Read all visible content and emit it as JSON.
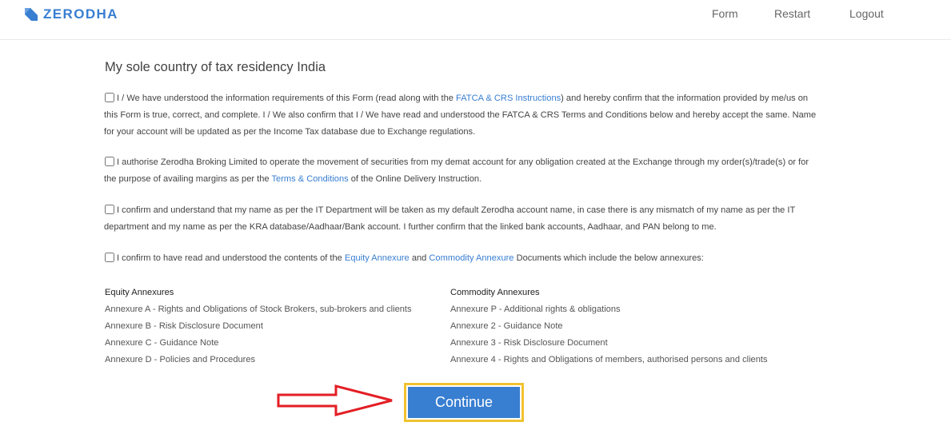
{
  "header": {
    "brand": "ZERODHA",
    "nav": {
      "form": "Form",
      "restart": "Restart",
      "logout": "Logout"
    }
  },
  "colors": {
    "accent": "#387ed1",
    "highlight_border": "#f2c230",
    "arrow": "#e31e24"
  },
  "title": "My sole country of tax residency India",
  "declarations": [
    {
      "checked": false,
      "t1": "I / We have understood the information requirements of this Form (read along with the ",
      "link1": "FATCA & CRS Instructions",
      "t2": ") and hereby confirm that the information provided by me/us on this Form is true, correct, and complete. I / We also confirm that I / We have read and understood the FATCA & CRS Terms and Conditions below and hereby accept the same. Name for your account will be updated as per the Income Tax database due to Exchange regulations."
    },
    {
      "checked": false,
      "t1": "I authorise Zerodha Broking Limited to operate the movement of securities from my demat account for any obligation created at the Exchange through my order(s)/trade(s) or for the purpose of availing margins as per the ",
      "link1": "Terms & Conditions",
      "t2": " of the Online Delivery Instruction."
    },
    {
      "checked": false,
      "t1": "I confirm and understand that my name as per the IT Department will be taken as my default Zerodha account name, in case there is any mismatch of my name as per the IT department and my name as per the KRA database/Aadhaar/Bank account. I further confirm that the linked bank accounts, Aadhaar, and PAN belong to me."
    },
    {
      "checked": false,
      "t1": "I confirm to have read and understood the contents of the ",
      "link1": "Equity Annexure",
      "t2": " and ",
      "link2": "Commodity Annexure",
      "t3": " Documents which include the below annexures:"
    }
  ],
  "annexures": {
    "equity": {
      "heading": "Equity Annexures",
      "items": [
        "Annexure A - Rights and Obligations of Stock Brokers, sub-brokers and clients",
        "Annexure B - Risk Disclosure Document",
        "Annexure C - Guidance Note",
        "Annexure D - Policies and Procedures"
      ]
    },
    "commodity": {
      "heading": "Commodity Annexures",
      "items": [
        "Annexure P - Additional rights & obligations",
        "Annexure 2 - Guidance Note",
        "Annexure 3 - Risk Disclosure Document",
        "Annexure 4 - Rights and Obligations of members, authorised persons and clients"
      ]
    }
  },
  "continue_label": "Continue",
  "icons": {
    "logo": "zerodha-logo-icon",
    "arrow": "arrow-right-icon"
  }
}
